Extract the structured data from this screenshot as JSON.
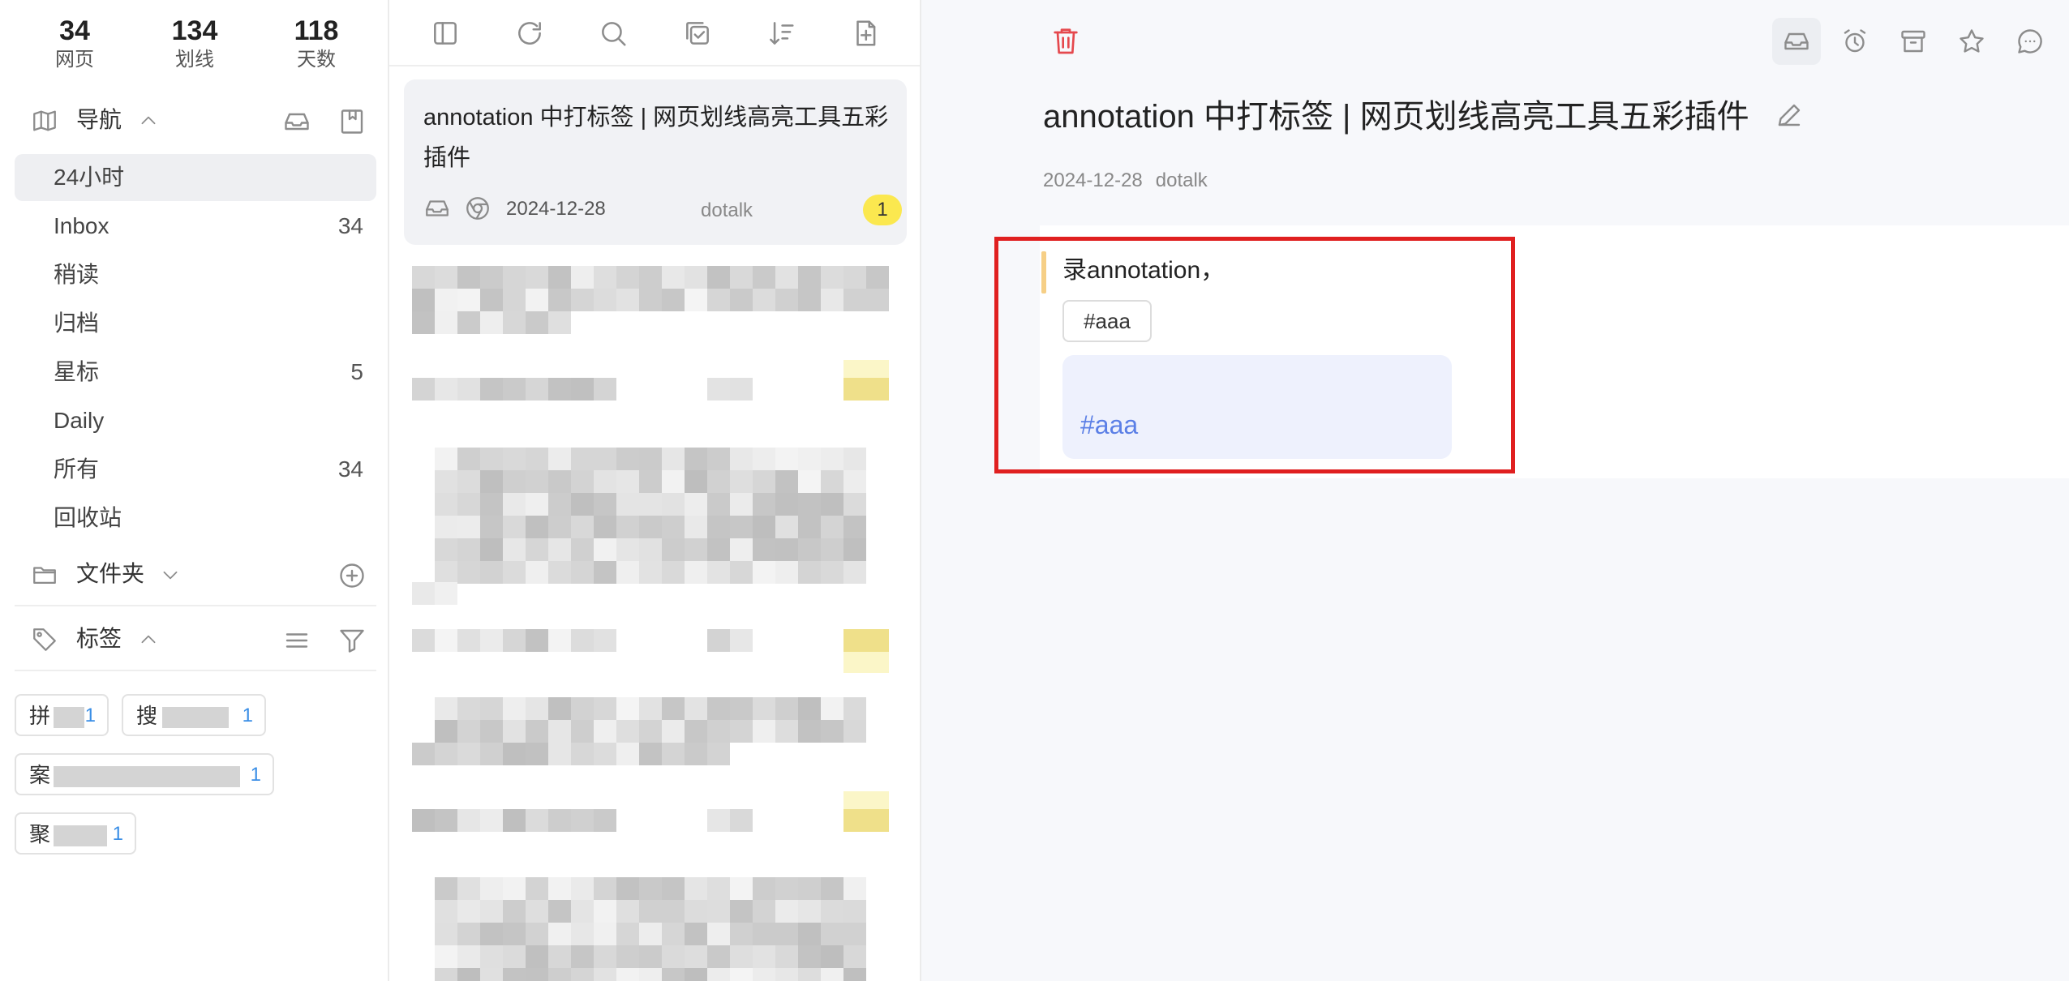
{
  "stats": [
    {
      "value": "34",
      "label": "网页"
    },
    {
      "value": "134",
      "label": "划线"
    },
    {
      "value": "118",
      "label": "天数"
    }
  ],
  "nav": {
    "title": "导航",
    "items": [
      {
        "label": "24小时",
        "count": ""
      },
      {
        "label": "Inbox",
        "count": "34"
      },
      {
        "label": "稍读",
        "count": ""
      },
      {
        "label": "归档",
        "count": ""
      },
      {
        "label": "星标",
        "count": "5"
      },
      {
        "label": "Daily",
        "count": ""
      },
      {
        "label": "所有",
        "count": "34"
      },
      {
        "label": "回收站",
        "count": ""
      }
    ]
  },
  "folders": {
    "title": "文件夹"
  },
  "tags": {
    "title": "标签",
    "chips": [
      {
        "prefix": "拼",
        "count": "1"
      },
      {
        "prefix": "搜",
        "count": "1"
      },
      {
        "prefix": "案",
        "count": "1"
      },
      {
        "prefix": "聚",
        "count": "1"
      }
    ]
  },
  "list": {
    "selected": {
      "title": "annotation 中打标签 | 网页划线高亮工具五彩插件",
      "date": "2024-12-28",
      "author": "dotalk",
      "badge": "1"
    }
  },
  "detail": {
    "title": "annotation 中打标签 | 网页划线高亮工具五彩插件",
    "date": "2024-12-28",
    "author": "dotalk",
    "annotation_text": "录annotation，",
    "annotation_tag": "#aaa",
    "note_text": "#aaa"
  },
  "colors": {
    "accent_blue": "#3a8ee6",
    "note_blue": "#5b7fe6",
    "highlight_bar": "#f6cf86",
    "badge_yellow": "#fbe84f",
    "trash_red": "#e5484d",
    "frame_red": "#e02020"
  },
  "icons": {
    "nav": "map-icon",
    "folders": "folder-icon",
    "tags": "tag-icon",
    "toolbar": [
      "sidebar-toggle-icon",
      "refresh-icon",
      "search-icon",
      "multi-select-icon",
      "sort-icon",
      "add-page-icon"
    ],
    "detail_toolbar": [
      "inbox-icon",
      "alarm-icon",
      "archive-icon",
      "star-icon",
      "comment-icon"
    ]
  }
}
